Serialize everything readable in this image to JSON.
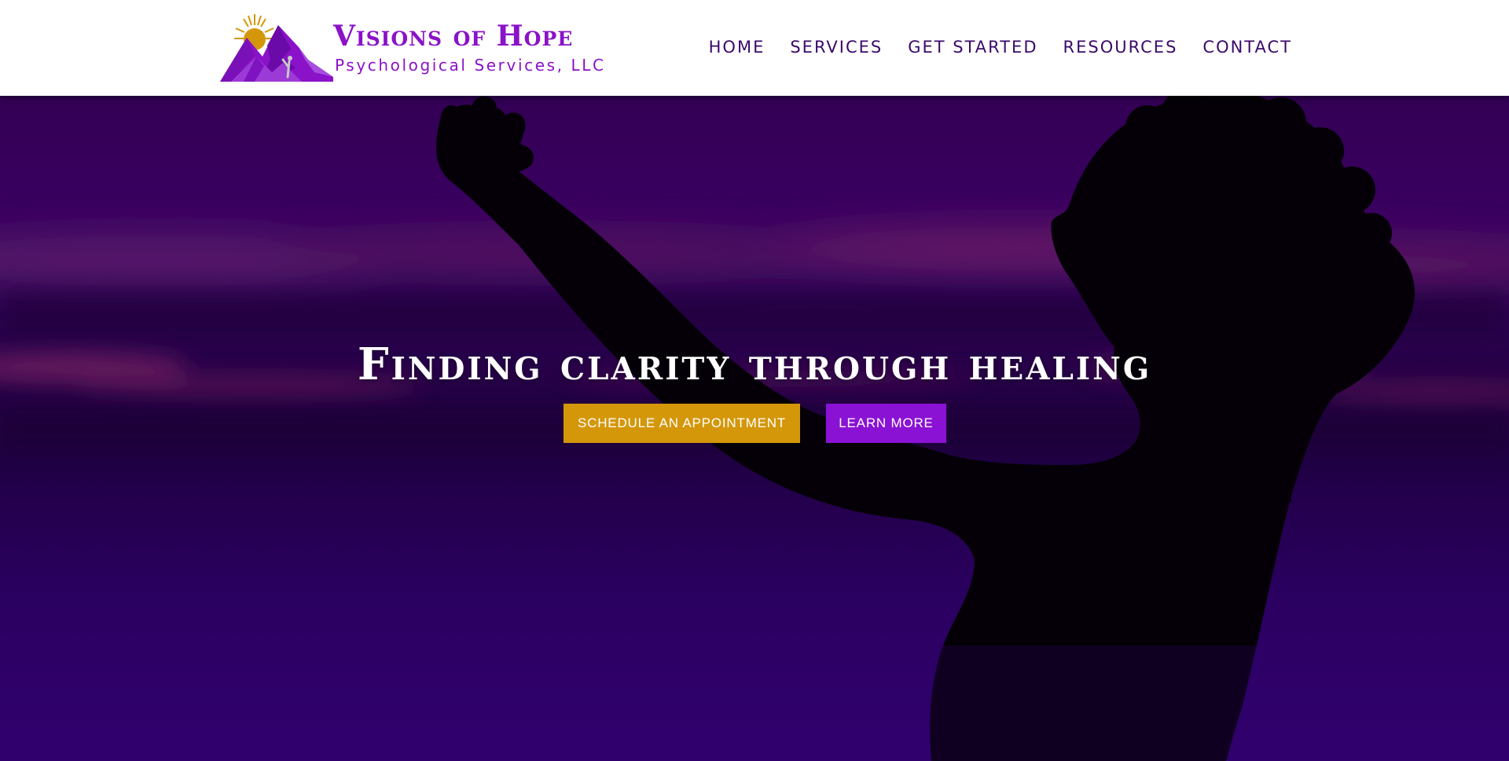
{
  "brand": {
    "name": "Visions of Hope",
    "tagline": "Psychological Services, LLC",
    "logo_icon": "mountain-sun-logo-icon"
  },
  "nav": {
    "items": [
      {
        "label": "HOME"
      },
      {
        "label": "SERVICES"
      },
      {
        "label": "GET STARTED"
      },
      {
        "label": "RESOURCES"
      },
      {
        "label": "CONTACT"
      }
    ]
  },
  "hero": {
    "title": "Finding clarity through healing",
    "primary_cta": "SCHEDULE AN APPOINTMENT",
    "secondary_cta": "LEARN MORE",
    "background_image": "silhouette-woman-arms-raised-sunset-photo"
  },
  "colors": {
    "brand_purple": "#8a12c8",
    "nav_text": "#3a0a6a",
    "primary_button": "#d4970a",
    "secondary_button": "#8a12d4",
    "hero_overlay": "#2a0050"
  }
}
